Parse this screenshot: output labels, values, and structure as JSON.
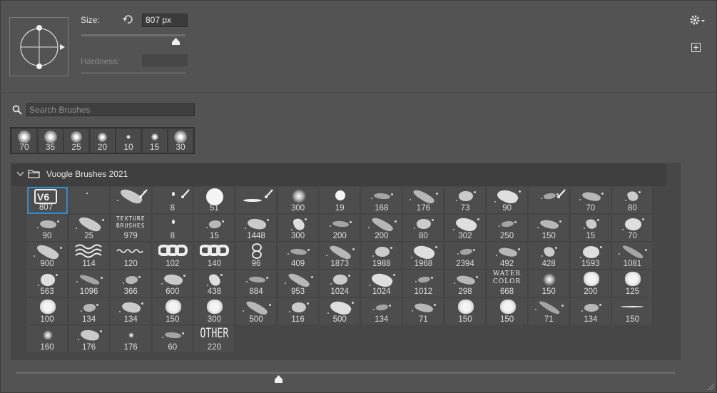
{
  "size": {
    "label": "Size:",
    "value": "807 px",
    "reset_icon": "reset-icon"
  },
  "hardness": {
    "label": "Hardness:",
    "value": ""
  },
  "search": {
    "placeholder": "Search Brushes",
    "icon": "search-icon"
  },
  "recent_brushes": [
    "70",
    "35",
    "25",
    "20",
    "10",
    "15",
    "30"
  ],
  "group": {
    "title": "Vuogle Brushes 2021",
    "folder_icon": "folder-icon",
    "chevron_icon": "chevron-down-icon"
  },
  "brushes": [
    [
      "807",
      "",
      "",
      "8",
      "51",
      "",
      "300",
      "19",
      "168",
      "176",
      "73",
      "90",
      "",
      "70",
      "80"
    ],
    [
      "90",
      "25",
      "979",
      "8",
      "15",
      "1448",
      "300",
      "200",
      "200",
      "80",
      "302",
      "250",
      "150",
      "15",
      "70"
    ],
    [
      "900",
      "114",
      "120",
      "102",
      "140",
      "96",
      "409",
      "1873",
      "1988",
      "1968",
      "2394",
      "492",
      "428",
      "1593",
      "1081"
    ],
    [
      "563",
      "1096",
      "366",
      "600",
      "438",
      "884",
      "953",
      "1024",
      "1024",
      "1012",
      "298",
      "668",
      "150",
      "200",
      "125"
    ],
    [
      "100",
      "134",
      "134",
      "150",
      "300",
      "500",
      "116",
      "500",
      "134",
      "71",
      "150",
      "150",
      "71",
      "134",
      "150"
    ],
    [
      "160",
      "176",
      "176",
      "60",
      "220"
    ]
  ],
  "thumb_text": {
    "texture1": "TEXTURE",
    "texture2": "BRUSHES",
    "water1": "WATER",
    "water2": "COLOR",
    "other": "OTHER"
  },
  "icons": {
    "settings": "gear-icon",
    "new_brush": "add-brush-icon"
  }
}
